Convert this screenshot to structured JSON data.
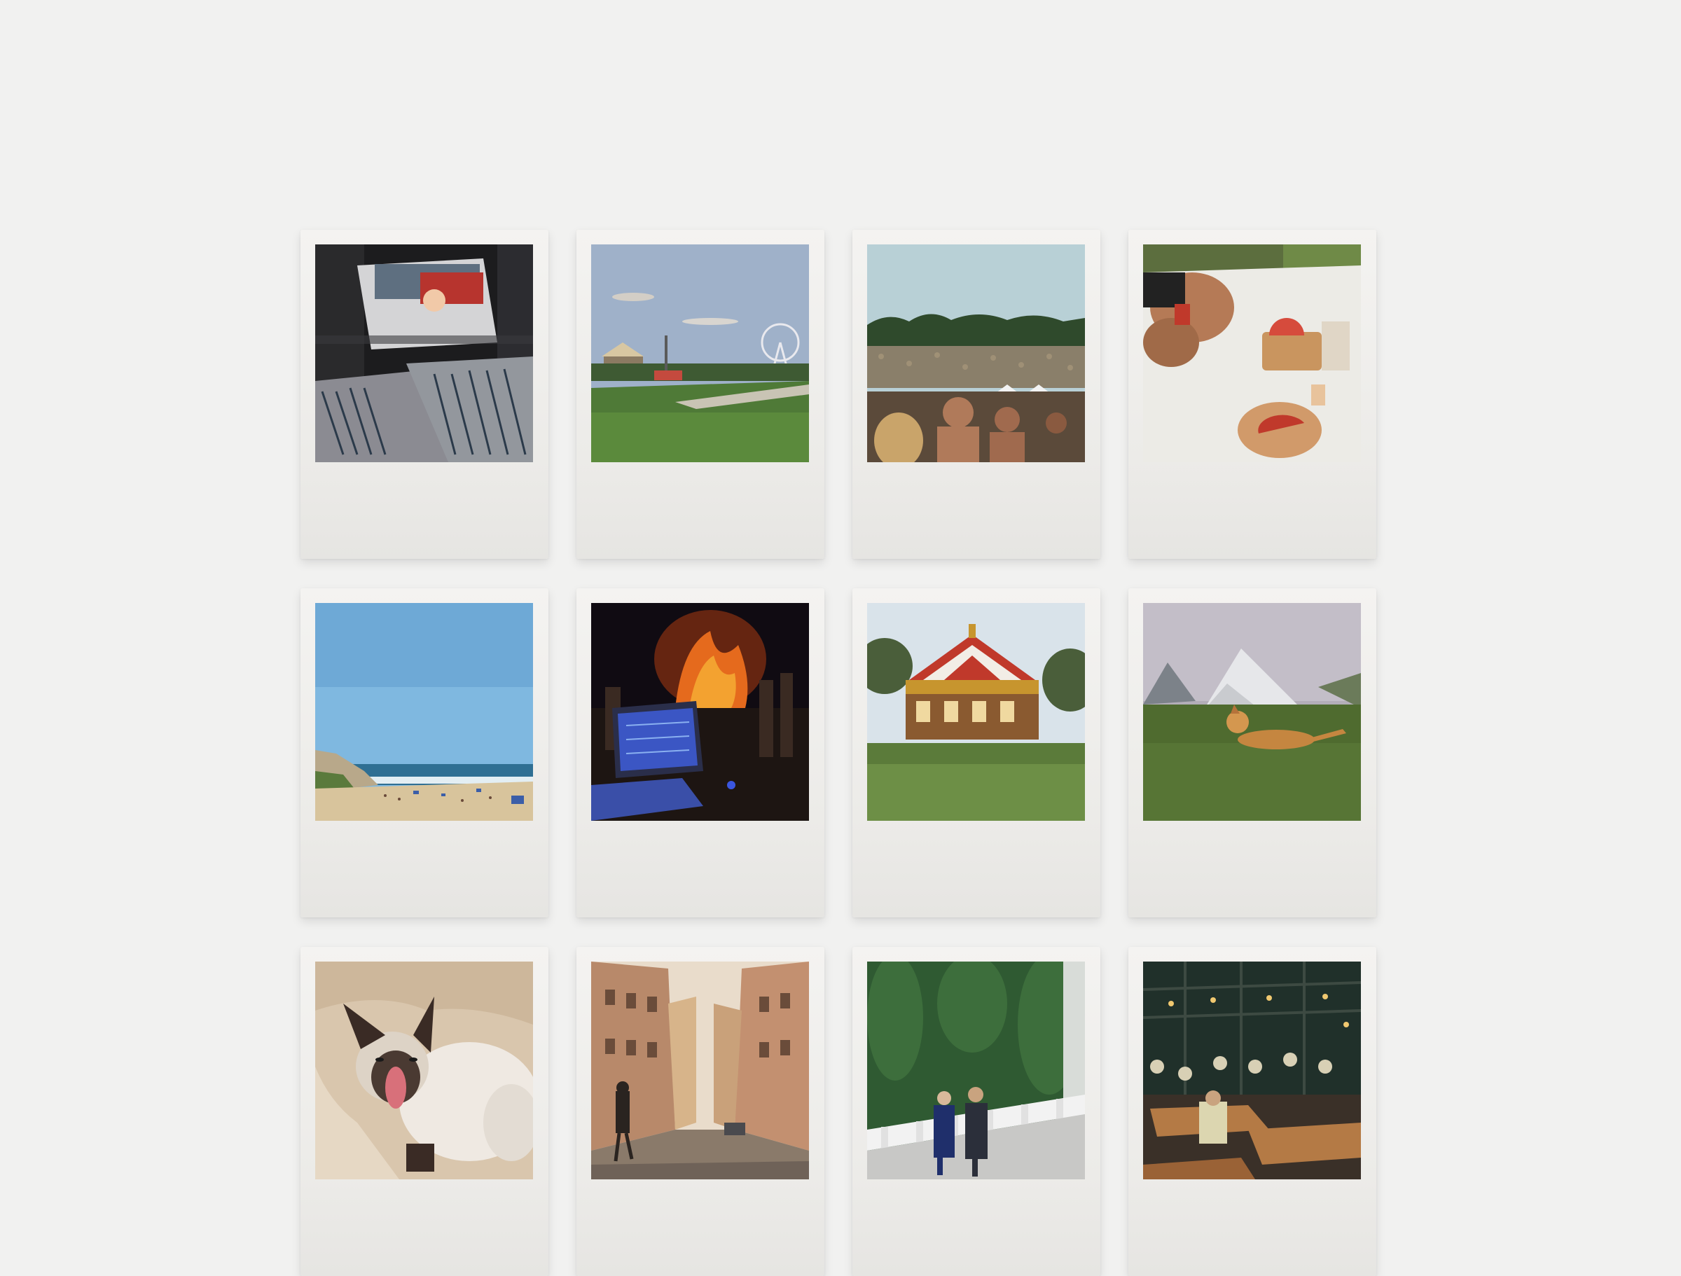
{
  "gallery": {
    "photos": [
      {
        "subject": "record-crates",
        "colors": [
          "#1c1c1e",
          "#b7342e",
          "#6d87a3"
        ]
      },
      {
        "subject": "fairground-park",
        "colors": [
          "#9db0c8",
          "#4e7a37",
          "#d8c7a2"
        ]
      },
      {
        "subject": "festival-crowd",
        "colors": [
          "#b8d0d6",
          "#2f4a2c",
          "#a07a5f"
        ]
      },
      {
        "subject": "watermelon-picnic",
        "colors": [
          "#ecece8",
          "#c0392b",
          "#8b5e3c"
        ]
      },
      {
        "subject": "beach",
        "colors": [
          "#79b3dc",
          "#2f6f93",
          "#d8c49c"
        ]
      },
      {
        "subject": "night-bonfire-laptop",
        "colors": [
          "#100b12",
          "#e56a1d",
          "#3b56c4"
        ]
      },
      {
        "subject": "carousel",
        "colors": [
          "#d9e3ea",
          "#c0392b",
          "#5b7b3a"
        ]
      },
      {
        "subject": "dog-tents-meadow",
        "colors": [
          "#b3aeb8",
          "#4f6b2f",
          "#c58640"
        ]
      },
      {
        "subject": "yawning-siamese-cat",
        "colors": [
          "#d9c6ad",
          "#3a2b25",
          "#d8707a"
        ]
      },
      {
        "subject": "rome-street",
        "colors": [
          "#b8896a",
          "#4a3a30",
          "#e9dccb"
        ]
      },
      {
        "subject": "dancing-couple",
        "colors": [
          "#2f5a32",
          "#f2f2f2",
          "#1f2f6b"
        ]
      },
      {
        "subject": "beer-garden",
        "colors": [
          "#20302a",
          "#b47a45",
          "#d8d0b5"
        ]
      }
    ]
  }
}
